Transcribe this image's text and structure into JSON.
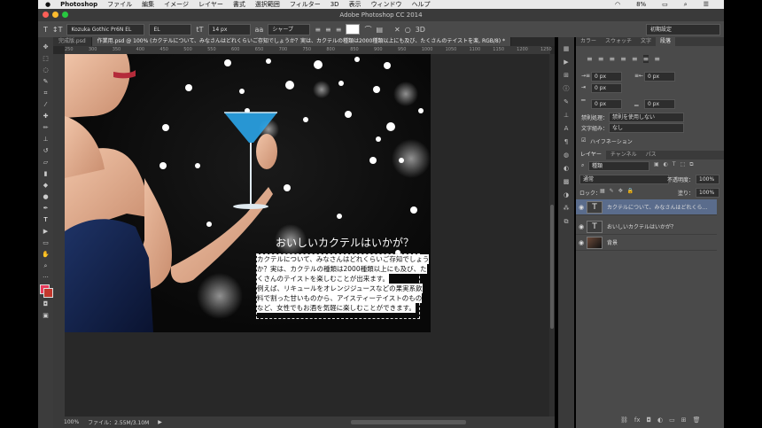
{
  "menubar": {
    "app": "Photoshop",
    "items": [
      "ファイル",
      "編集",
      "イメージ",
      "レイヤー",
      "書式",
      "選択範囲",
      "フィルター",
      "3D",
      "表示",
      "ウィンドウ",
      "ヘルプ"
    ],
    "battery": "8%",
    "clock": ""
  },
  "window": {
    "title": "Adobe Photoshop CC 2014"
  },
  "options": {
    "font_family": "Kozuka Gothic Pr6N EL",
    "font_style": "EL",
    "font_size": "14 px",
    "antialias": "シャープ",
    "workspace": "初期設定"
  },
  "tabs": [
    {
      "label": "完成版.psd"
    },
    {
      "label": "作業用.psd @ 100% (カクテルについて、みなさんはどれくらいご存知でしょうか？実は、カクテルの種類は2000種類以上にも及び、たくさんのテイストを楽, RGB/8) *"
    }
  ],
  "ruler": {
    "ticks": [
      "250",
      "300",
      "350",
      "400",
      "450",
      "500",
      "550",
      "600",
      "650",
      "700",
      "750",
      "800",
      "850",
      "900",
      "950",
      "1000",
      "1050",
      "1100",
      "1150",
      "1200",
      "1250"
    ]
  },
  "canvas": {
    "heading": "おいしいカクテルはいかが？",
    "body_lines": [
      "カクテルについて、みなさんはどれくらいご存知でしょう",
      "か？実は、カクテルの種類は2000種類以上にも及び、た",
      "くさんのテイストを楽しむことが出来ます。",
      "例えば、リキュールをオレンジジュースなどの果実系飲",
      "料で割った甘いものから、アイスティーテイストのもの",
      "など、女性でもお酒を気軽に楽しむことができます。"
    ]
  },
  "status": {
    "zoom": "100%",
    "file": "ファイル：2.55M/3.10M"
  },
  "character_panel": {
    "tabs": [
      "カラー",
      "スウォッチ",
      "文字",
      "段落"
    ],
    "indent_left": "0 px",
    "indent_right": "0 px",
    "first_line": "0 px",
    "space_before": "0 px",
    "space_after": "0 px",
    "kinsoku_label": "禁則処理：",
    "kinsoku_value": "禁則を使用しない",
    "mojikumi_label": "文字組み：",
    "mojikumi_value": "なし",
    "hyphenation": "ハイフネーション"
  },
  "layers_panel": {
    "tabs": [
      "レイヤー",
      "チャンネル",
      "パス"
    ],
    "filter": "種類",
    "blend": "通常",
    "opacity_label": "不透明度：",
    "opacity": "100%",
    "lock_label": "ロック：",
    "fill_label": "塗り：",
    "fill": "100%",
    "layers": [
      {
        "name": "カクテルについて、みなさんはどれくら...",
        "type": "T",
        "selected": true
      },
      {
        "name": "おいしいカクテルはいかが？",
        "type": "T",
        "selected": false
      },
      {
        "name": "背景",
        "type": "image",
        "selected": false
      }
    ]
  }
}
